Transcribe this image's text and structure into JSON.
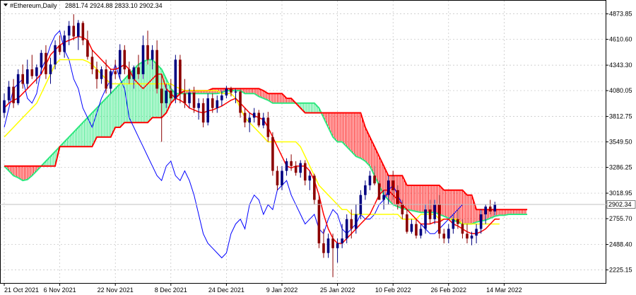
{
  "header": {
    "symbol": "#Ethereum,Daily",
    "ohlc": "2881.74 2924.88 2833.10 2902.34"
  },
  "current_price_label": "2902.34",
  "colors": {
    "bull_candle": "#000080",
    "bear_candle": "#8b0000",
    "tenkan": "#ff0000",
    "kijun": "#0000ff",
    "chikou": "#ffff00",
    "span_a": "#2ee87f",
    "span_b": "#ff0000",
    "cloud_bull": "#2ee87f",
    "cloud_bear": "#ff0000",
    "grid": "#c0c0c0",
    "frame": "#000000"
  },
  "chart_data": {
    "type": "candlestick",
    "indicator": "Ichimoku",
    "y_tick_labels": [
      "4873.85",
      "4610.60",
      "4343.30",
      "4080.05",
      "3812.75",
      "3549.50",
      "3286.25",
      "3018.95",
      "2755.70",
      "2488.40",
      "2225.15"
    ],
    "y_ticks": [
      4873.85,
      4610.6,
      4343.3,
      4080.05,
      3812.75,
      3549.5,
      3286.25,
      3018.95,
      2755.7,
      2488.4,
      2225.15
    ],
    "ylim": [
      2090,
      5010
    ],
    "x_tick_labels": [
      "21 Oct 2021",
      "6 Nov 2021",
      "22 Nov 2021",
      "8 Dec 2021",
      "24 Dec 2021",
      "9 Jan 2022",
      "25 Jan 2022",
      "10 Feb 2022",
      "26 Feb 2022",
      "14 Mar 2022"
    ],
    "candles": [
      [
        3850,
        4050,
        3800,
        3980
      ],
      [
        3980,
        4180,
        3950,
        4120
      ],
      [
        4120,
        4200,
        3900,
        3950
      ],
      [
        3950,
        4300,
        3930,
        4250
      ],
      [
        4250,
        4350,
        4100,
        4150
      ],
      [
        4150,
        4400,
        4100,
        4300
      ],
      [
        4300,
        4450,
        4200,
        4230
      ],
      [
        4230,
        4350,
        4150,
        4320
      ],
      [
        4320,
        4500,
        4250,
        4470
      ],
      [
        4470,
        4550,
        4200,
        4250
      ],
      [
        4250,
        4420,
        4150,
        4350
      ],
      [
        4350,
        4600,
        4300,
        4550
      ],
      [
        4550,
        4650,
        4450,
        4480
      ],
      [
        4480,
        4700,
        4420,
        4650
      ],
      [
        4650,
        4800,
        4550,
        4750
      ],
      [
        4750,
        4870,
        4600,
        4640
      ],
      [
        4640,
        4810,
        4500,
        4780
      ],
      [
        4780,
        4800,
        4550,
        4600
      ],
      [
        4600,
        4700,
        4400,
        4430
      ],
      [
        4430,
        4500,
        4250,
        4300
      ],
      [
        4300,
        4380,
        4100,
        4200
      ],
      [
        4200,
        4330,
        4150,
        4300
      ],
      [
        4300,
        4400,
        4050,
        4100
      ],
      [
        4100,
        4300,
        4050,
        4280
      ],
      [
        4280,
        4400,
        4200,
        4250
      ],
      [
        4250,
        4560,
        4200,
        4500
      ],
      [
        4500,
        4550,
        4250,
        4300
      ],
      [
        4300,
        4380,
        4150,
        4200
      ],
      [
        4200,
        4340,
        4100,
        4320
      ],
      [
        4320,
        4450,
        4200,
        4250
      ],
      [
        4250,
        4650,
        4200,
        4550
      ],
      [
        4550,
        4700,
        4350,
        4400
      ],
      [
        4400,
        4550,
        4300,
        4500
      ],
      [
        4500,
        4600,
        4050,
        4100
      ],
      [
        4100,
        4250,
        3550,
        3950
      ],
      [
        3950,
        4150,
        3900,
        4080
      ],
      [
        4080,
        4200,
        3950,
        4000
      ],
      [
        4000,
        4450,
        3950,
        4400
      ],
      [
        4400,
        4450,
        3950,
        4050
      ],
      [
        4050,
        4200,
        3900,
        3950
      ],
      [
        3950,
        4100,
        3900,
        4060
      ],
      [
        4060,
        4120,
        3850,
        3900
      ],
      [
        3900,
        4000,
        3780,
        3950
      ],
      [
        3950,
        4000,
        3700,
        3750
      ],
      [
        3750,
        4050,
        3720,
        4000
      ],
      [
        4000,
        4050,
        3850,
        3900
      ],
      [
        3900,
        4030,
        3850,
        3980
      ],
      [
        3980,
        4080,
        3920,
        4030
      ],
      [
        4030,
        4130,
        4000,
        4100
      ],
      [
        4100,
        4120,
        4020,
        4060
      ],
      [
        4060,
        4100,
        3950,
        4070
      ],
      [
        4070,
        4100,
        3800,
        3850
      ],
      [
        3850,
        3900,
        3700,
        3750
      ],
      [
        3750,
        3850,
        3650,
        3800
      ],
      [
        3800,
        3900,
        3750,
        3850
      ],
      [
        3850,
        3880,
        3700,
        3720
      ],
      [
        3720,
        3850,
        3690,
        3800
      ],
      [
        3800,
        3860,
        3550,
        3600
      ],
      [
        3600,
        3650,
        3200,
        3250
      ],
      [
        3250,
        3300,
        3050,
        3100
      ],
      [
        3100,
        3300,
        3050,
        3250
      ],
      [
        3250,
        3380,
        3200,
        3350
      ],
      [
        3350,
        3420,
        3250,
        3300
      ],
      [
        3300,
        3350,
        3200,
        3230
      ],
      [
        3230,
        3360,
        3180,
        3330
      ],
      [
        3330,
        3360,
        3100,
        3150
      ],
      [
        3150,
        3250,
        3050,
        3200
      ],
      [
        3200,
        3220,
        2900,
        2950
      ],
      [
        2950,
        3000,
        2450,
        2500
      ],
      [
        2500,
        2650,
        2350,
        2400
      ],
      [
        2400,
        2600,
        2350,
        2550
      ],
      [
        2550,
        2600,
        2150,
        2450
      ],
      [
        2450,
        2550,
        2300,
        2500
      ],
      [
        2500,
        2700,
        2450,
        2550
      ],
      [
        2550,
        2800,
        2500,
        2750
      ],
      [
        2750,
        2850,
        2550,
        2650
      ],
      [
        2650,
        2900,
        2600,
        2800
      ],
      [
        2800,
        3050,
        2750,
        3000
      ],
      [
        3000,
        3150,
        2950,
        3100
      ],
      [
        3100,
        3250,
        3050,
        3200
      ],
      [
        3200,
        3300,
        3100,
        3120
      ],
      [
        3120,
        3150,
        2950,
        2950
      ],
      [
        2950,
        3050,
        2850,
        3000
      ],
      [
        3000,
        3200,
        2900,
        3150
      ],
      [
        3150,
        3250,
        2950,
        3050
      ],
      [
        3050,
        3100,
        2850,
        2900
      ],
      [
        2900,
        2950,
        2750,
        2800
      ],
      [
        2800,
        2850,
        2600,
        2620
      ],
      [
        2620,
        2750,
        2600,
        2700
      ],
      [
        2700,
        2750,
        2550,
        2580
      ],
      [
        2580,
        2700,
        2550,
        2650
      ],
      [
        2650,
        2900,
        2600,
        2850
      ],
      [
        2850,
        2950,
        2700,
        2750
      ],
      [
        2750,
        2950,
        2700,
        2900
      ],
      [
        2900,
        3000,
        2550,
        2600
      ],
      [
        2600,
        2650,
        2500,
        2550
      ],
      [
        2550,
        2700,
        2500,
        2650
      ],
      [
        2650,
        2800,
        2600,
        2750
      ],
      [
        2750,
        2850,
        2650,
        2700
      ],
      [
        2700,
        2750,
        2550,
        2600
      ],
      [
        2600,
        2700,
        2500,
        2550
      ],
      [
        2550,
        2620,
        2480,
        2580
      ],
      [
        2580,
        2700,
        2500,
        2650
      ],
      [
        2650,
        2850,
        2600,
        2800
      ],
      [
        2800,
        2900,
        2700,
        2880
      ],
      [
        2880,
        2950,
        2800,
        2830
      ],
      [
        2830,
        2930,
        2790,
        2902
      ]
    ],
    "tenkan": [
      3900,
      3950,
      3980,
      4000,
      4050,
      4100,
      4150,
      4200,
      4250,
      4350,
      4450,
      4500,
      4550,
      4580,
      4600,
      4620,
      4640,
      4630,
      4600,
      4500,
      4450,
      4400,
      4350,
      4300,
      4300,
      4320,
      4350,
      4300,
      4200,
      4150,
      4100,
      4150,
      4200,
      4250,
      4250,
      4100,
      4050,
      4000,
      3980,
      3950,
      3900,
      3880,
      3860,
      3850,
      3870,
      3880,
      3900,
      3920,
      3950,
      3980,
      4000,
      3950,
      3900,
      3850,
      3820,
      3800,
      3780,
      3700,
      3600,
      3500,
      3400,
      3300,
      3280,
      3300,
      3300,
      3300,
      3250,
      3150,
      3000,
      2800,
      2650,
      2550,
      2500,
      2500,
      2550,
      2600,
      2650,
      2700,
      2750,
      2800,
      2900,
      3000,
      3050,
      3050,
      3000,
      2950,
      2900,
      2850,
      2800,
      2750,
      2700,
      2700,
      2700,
      2720,
      2720,
      2750,
      2750,
      2700,
      2680,
      2650,
      2620,
      2600,
      2600,
      2620,
      2650,
      2700,
      2750,
      2750
    ],
    "kijun": [
      3600,
      3650,
      3700,
      3750,
      3800,
      3850,
      3900,
      3950,
      4050,
      4150,
      4250,
      4350,
      4400,
      4400,
      4400,
      4400,
      4400,
      4400,
      4380,
      4350,
      4300,
      4250,
      4200,
      4150,
      4150,
      4150,
      4150,
      4150,
      4150,
      4150,
      4150,
      4150,
      4150,
      4150,
      4150,
      4150,
      4150,
      4120,
      4100,
      4080,
      4080,
      4080,
      4080,
      4080,
      4080,
      4080,
      4080,
      4050,
      4050,
      4050,
      4000,
      3900,
      3800,
      3750,
      3700,
      3650,
      3600,
      3550,
      3550,
      3550,
      3550,
      3550,
      3550,
      3550,
      3500,
      3400,
      3300,
      3200,
      3100,
      3050,
      3000,
      2950,
      2900,
      2850,
      2850,
      2800,
      2800,
      2800,
      2800,
      2800,
      2800,
      2800,
      2800,
      2800,
      2800,
      2800,
      2750,
      2750,
      2750,
      2750,
      2800,
      2800,
      2800,
      2800,
      2750,
      2750,
      2750,
      2750,
      2750,
      2700,
      2700,
      2700,
      2700,
      2700,
      2700,
      2700,
      2700,
      2700
    ],
    "chikou": [
      3700,
      3900,
      4100,
      4150,
      4200,
      4000,
      3950,
      4050,
      4300,
      4400,
      4550,
      4650,
      4700,
      4500,
      4400,
      4200,
      4100,
      3900,
      3800,
      3700,
      3850,
      4000,
      4100,
      4200,
      4350,
      4200,
      4100,
      3800,
      3700,
      3600,
      3500,
      3400,
      3300,
      3200,
      3150,
      3300,
      3350,
      3200,
      3150,
      3250,
      3150,
      3000,
      2800,
      2600,
      2500,
      2450,
      2400,
      2350,
      2400,
      2600,
      2700,
      2750,
      2650,
      2900,
      3000,
      2950,
      2800,
      2900,
      2850,
      3050,
      3100,
      3150,
      3000,
      2900,
      2800,
      2700,
      2750,
      2800,
      2650,
      2600,
      2750,
      2850,
      2800,
      2650,
      2600,
      2650,
      2700,
      2800,
      2750,
      2750,
      2800,
      2900,
      2950,
      3050,
      3100,
      3000,
      2900,
      2850,
      2800,
      2750,
      2700,
      2650,
      2600,
      2600,
      2650,
      2700,
      2750,
      2800,
      2850,
      2900
    ],
    "span_a": [
      3300,
      3250,
      3200,
      3180,
      3150,
      3160,
      3200,
      3250,
      3300,
      3350,
      3400,
      3450,
      3500,
      3550,
      3600,
      3650,
      3700,
      3750,
      3800,
      3850,
      3900,
      3950,
      4000,
      4050,
      4100,
      4150,
      4200,
      4250,
      4300,
      4350,
      4380,
      4400,
      4400,
      4350,
      4300,
      4200,
      4100,
      4050,
      4050,
      4050,
      4050,
      4050,
      4050,
      4050,
      4050,
      4050,
      4050,
      4060,
      4080,
      4080,
      4080,
      4080,
      4050,
      4050,
      4050,
      4020,
      4000,
      3980,
      3950,
      3950,
      3950,
      3950,
      3950,
      3950,
      3950,
      3950,
      3950,
      3950,
      3900,
      3800,
      3700,
      3600,
      3550,
      3550,
      3500,
      3450,
      3400,
      3380,
      3350,
      3300,
      3200,
      3100,
      3000,
      2950,
      2900,
      2880,
      2860,
      2850,
      2840,
      2830,
      2820,
      2820,
      2820,
      2820,
      2800,
      2780,
      2760,
      2740,
      2720,
      2700,
      2700,
      2700,
      2720,
      2730,
      2740,
      2760,
      2780,
      2790,
      2790,
      2800,
      2800,
      2800,
      2800,
      2800
    ],
    "span_b": [
      3300,
      3300,
      3300,
      3300,
      3300,
      3300,
      3300,
      3300,
      3300,
      3300,
      3300,
      3300,
      3500,
      3500,
      3500,
      3500,
      3500,
      3500,
      3500,
      3500,
      3600,
      3600,
      3600,
      3600,
      3700,
      3700,
      3750,
      3750,
      3750,
      3750,
      3750,
      3750,
      3800,
      3800,
      3800,
      3850,
      3950,
      4000,
      4050,
      4080,
      4080,
      4080,
      4080,
      4080,
      4080,
      4100,
      4100,
      4100,
      4100,
      4100,
      4100,
      4100,
      4100,
      4100,
      4100,
      4100,
      4080,
      4050,
      4050,
      4050,
      4050,
      4000,
      4000,
      3950,
      3900,
      3850,
      3850,
      3850,
      3850,
      3850,
      3850,
      3850,
      3850,
      3850,
      3850,
      3850,
      3850,
      3850,
      3700,
      3600,
      3500,
      3400,
      3300,
      3200,
      3200,
      3200,
      3200,
      3100,
      3100,
      3100,
      3100,
      3100,
      3100,
      3100,
      3100,
      3050,
      3050,
      3050,
      3050,
      3050,
      3000,
      3000,
      2850,
      2850,
      2850,
      2850,
      2850,
      2850,
      2850,
      2850,
      2850,
      2850,
      2850,
      2850
    ]
  }
}
